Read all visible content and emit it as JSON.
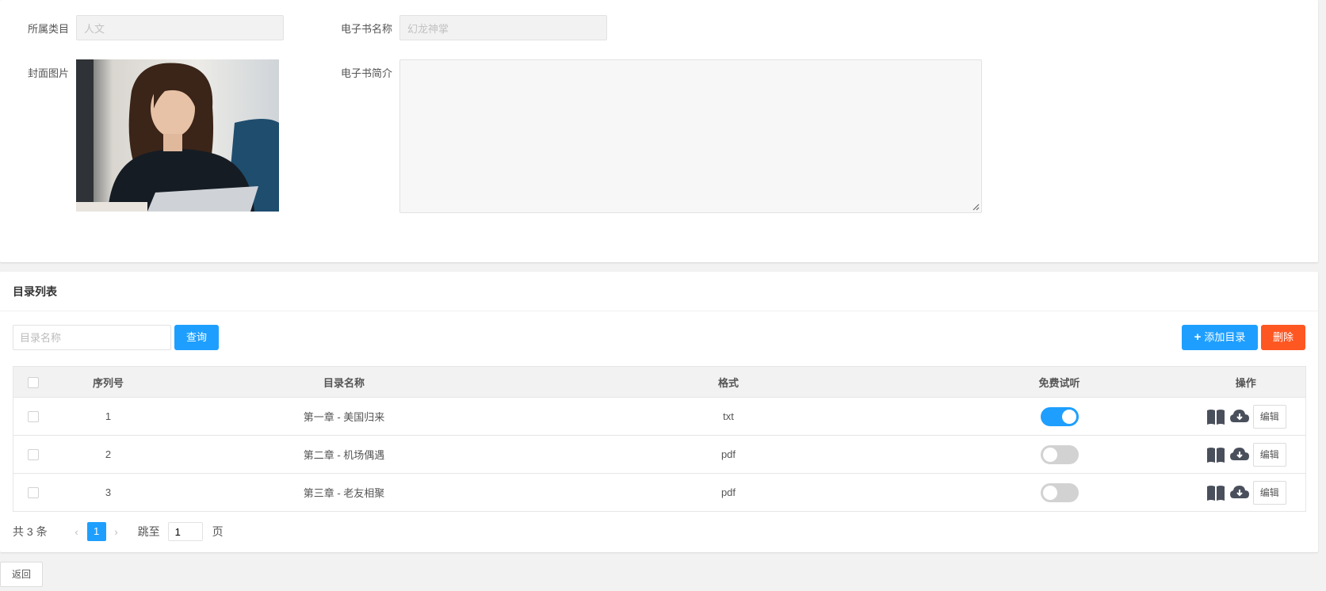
{
  "form": {
    "category_label": "所属类目",
    "category_value": "人文",
    "ebook_name_label": "电子书名称",
    "ebook_name_value": "幻龙神掌",
    "cover_label": "封面图片",
    "intro_label": "电子书简介",
    "intro_value": ""
  },
  "catalog": {
    "panel_title": "目录列表",
    "search_placeholder": "目录名称",
    "query_label": "查询",
    "add_label": "添加目录",
    "delete_label": "删除",
    "columns": [
      "序列号",
      "目录名称",
      "格式",
      "免费试听",
      "操作"
    ],
    "rows": [
      {
        "seq": "1",
        "name": "第一章 - 美国归来",
        "format": "txt",
        "free_trial": true,
        "edit_label": "编辑"
      },
      {
        "seq": "2",
        "name": "第二章 - 机场偶遇",
        "format": "pdf",
        "free_trial": false,
        "edit_label": "编辑"
      },
      {
        "seq": "3",
        "name": "第三章 - 老友相聚",
        "format": "pdf",
        "free_trial": false,
        "edit_label": "编辑"
      }
    ]
  },
  "pager": {
    "total_text": "共 3 条",
    "prev_glyph": "‹",
    "current_page": "1",
    "next_glyph": "›",
    "jump_label": "跳至",
    "jump_value": "1",
    "page_suffix": "页"
  },
  "back_label": "返回",
  "colors": {
    "primary": "#1e9fff",
    "danger": "#ff5722",
    "switch_off": "#d2d2d2"
  },
  "icons": {
    "read": "book-open-icon",
    "download": "cloud-download-icon",
    "add": "plus-icon"
  }
}
